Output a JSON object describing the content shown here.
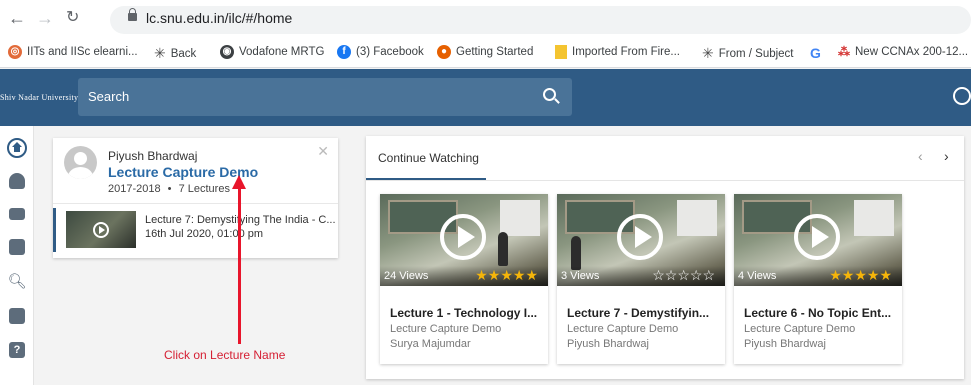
{
  "browser": {
    "url": "lc.snu.edu.in/ilc/#/home",
    "bookmarks": [
      {
        "label": "IITs and IISc elearni...",
        "icon": "iits-icon",
        "color": "#e26b3a"
      },
      {
        "label": "Back",
        "icon": "asterisk-icon",
        "color": "#4d4d4d"
      },
      {
        "label": "Vodafone MRTG",
        "icon": "globe-icon",
        "color": "#3c4043"
      },
      {
        "label": "(3) Facebook",
        "icon": "facebook-icon",
        "color": "#1877f2"
      },
      {
        "label": "Getting Started",
        "icon": "firefox-icon",
        "color": "#e66000"
      },
      {
        "label": "Imported From Fire...",
        "icon": "folder-icon",
        "color": "#f4c430"
      },
      {
        "label": "From / Subject",
        "icon": "asterisk-icon",
        "color": "#4d4d4d"
      },
      {
        "label": "",
        "icon": "google-icon",
        "color": "#4285f4"
      },
      {
        "label": "New CCNAx 200-12...",
        "icon": "ccna-icon",
        "color": "#d3302f"
      }
    ]
  },
  "header": {
    "logo": "Shiv Nadar University",
    "search_placeholder": "Search",
    "accent": "#2f5b85"
  },
  "left_card": {
    "presenter": "Piyush Bhardwaj",
    "course": "Lecture Capture Demo",
    "year": "2017-2018",
    "separator": "•",
    "lectures": "7 Lectures",
    "lecture_title": "Lecture 7: Demystifying The India - C...",
    "lecture_date": "16th Jul 2020, 01:00 pm"
  },
  "annotation": {
    "text": "Click on Lecture Name",
    "color": "#e8152b"
  },
  "continue_watching": {
    "tab_label": "Continue Watching",
    "prev": "‹",
    "next": "›",
    "videos": [
      {
        "views": "24 Views",
        "rating": 5,
        "stars": "★★★★★",
        "title": "Lecture 1 - Technology I...",
        "course": "Lecture Capture Demo",
        "author": "Surya Majumdar"
      },
      {
        "views": "3 Views",
        "rating": 0,
        "stars": "☆☆☆☆☆",
        "title": "Lecture 7 - Demystifyin...",
        "course": "Lecture Capture Demo",
        "author": "Piyush Bhardwaj"
      },
      {
        "views": "4 Views",
        "rating": 5,
        "stars": "★★★★★",
        "title": "Lecture 6 - No Topic Ent...",
        "course": "Lecture Capture Demo",
        "author": "Piyush Bhardwaj"
      }
    ]
  }
}
